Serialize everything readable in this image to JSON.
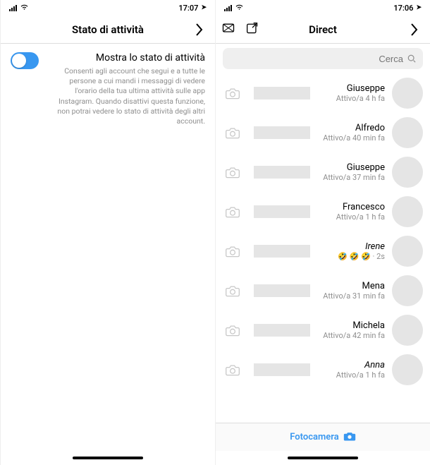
{
  "status": {
    "time_left": "17:06",
    "time_right": "17:07",
    "location_glyph": "➤"
  },
  "direct": {
    "title": "Direct",
    "search_placeholder": "Cerca",
    "chats": [
      {
        "name": "Giuseppe",
        "status": "Attivo/a 4 h fa",
        "preview": ""
      },
      {
        "name": "Alfredo",
        "status": "Attivo/a 40 min fa",
        "preview": ""
      },
      {
        "name": "Giuseppe",
        "status": "Attivo/a 37 min fa",
        "preview": ""
      },
      {
        "name": "Francesco",
        "status": "Attivo/a 1 h fa",
        "preview": ""
      },
      {
        "name": "Irene",
        "status": "🤣 🤣 🤣 · 2s",
        "preview": "",
        "italic": true
      },
      {
        "name": "Mena",
        "status": "Attivo/a 31 min fa",
        "preview": ""
      },
      {
        "name": "Michela",
        "status": "Attivo/a 42 min fa",
        "preview": ""
      },
      {
        "name": "Anna",
        "status": "Attivo/a 1 h fa",
        "preview": "",
        "italic": true
      }
    ],
    "camera_label": "Fotocamera"
  },
  "settings": {
    "title": "Stato di attività",
    "row_title": "Mostra lo stato di attività",
    "row_desc": "Consenti agli account che segui e a tutte le persone a cui mandi i messaggi di vedere l'orario della tua ultima attività sulle app Instagram. Quando disattivi questa funzione, non potrai vedere lo stato di attività degli altri account.",
    "toggle_on": true
  }
}
